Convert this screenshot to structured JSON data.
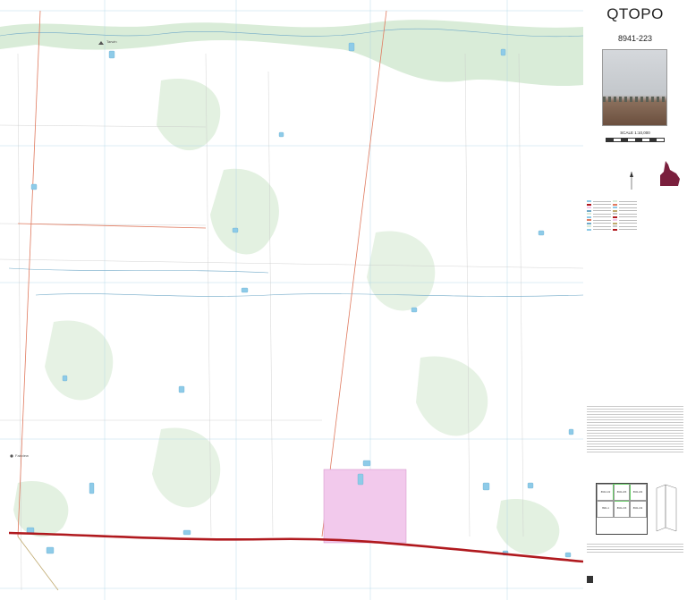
{
  "panel": {
    "title": "QTOPO",
    "sheet_number": "8941-223",
    "scale": "SCALE 1:10,000"
  },
  "colors": {
    "background": "#ffffff",
    "vegetation": "#d9ecd8",
    "water": "#8ecbe8",
    "highway": "#b0191e",
    "powerline": "#e07a5f",
    "reserve_fill": "#f2c9ec",
    "grid": "#a8d3e6",
    "creek": "#70a9c8",
    "qld_map": "#7a1f3d"
  },
  "map": {
    "place_labels": [
      "Tarwin",
      "Fairview"
    ],
    "map_layers": [
      "vegetation",
      "watercourses",
      "waterbodies",
      "roads",
      "state-highway",
      "powerlines",
      "reserve",
      "grid"
    ]
  },
  "index_map": {
    "sheets": [
      "8941-122",
      "8941-223",
      "8941-224",
      "8941-1",
      "8941-213",
      "8941-214"
    ]
  },
  "icons": [
    "north-arrow-icon",
    "qld-locator-icon",
    "agency-logo-icon",
    "homestead-icon"
  ]
}
